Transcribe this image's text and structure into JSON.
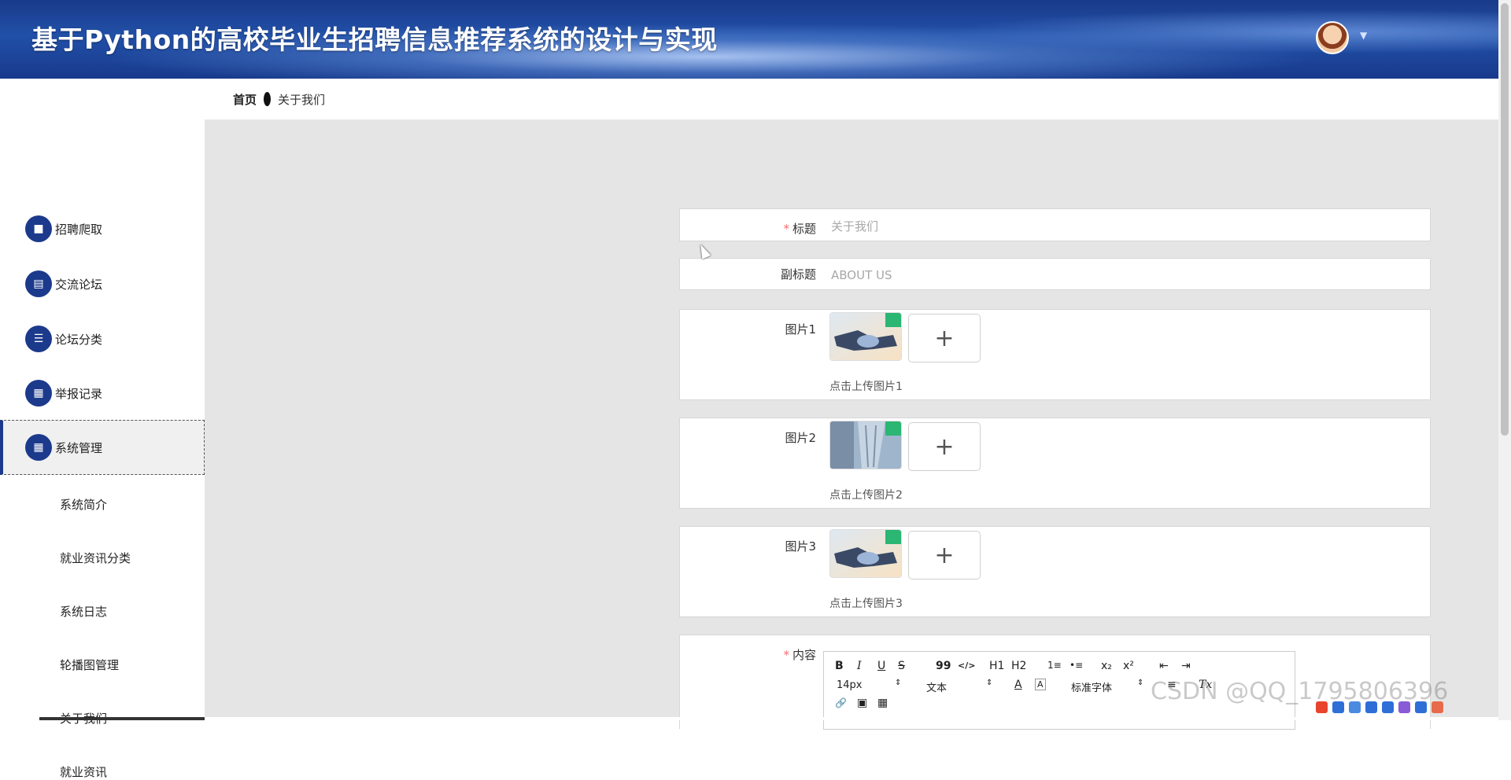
{
  "header": {
    "title": "基于Python的高校毕业生招聘信息推荐系统的设计与实现"
  },
  "breadcrumb": {
    "home": "首页",
    "current": "关于我们"
  },
  "sidebar": {
    "items": [
      {
        "label": "招聘爬取",
        "icon": "briefcase-icon"
      },
      {
        "label": "交流论坛",
        "icon": "clipboard-icon"
      },
      {
        "label": "论坛分类",
        "icon": "list-icon"
      },
      {
        "label": "举报记录",
        "icon": "grid-icon"
      },
      {
        "label": "系统管理",
        "icon": "grid-icon",
        "active": true
      }
    ],
    "sub_items": [
      "系统简介",
      "就业资讯分类",
      "系统日志",
      "轮播图管理",
      "关于我们",
      "就业资讯"
    ]
  },
  "form": {
    "title_label": "标题",
    "title_value": "关于我们",
    "subtitle_label": "副标题",
    "subtitle_value": "ABOUT US",
    "pic1_label": "图片1",
    "pic1_tip": "点击上传图片1",
    "pic2_label": "图片2",
    "pic2_tip": "点击上传图片2",
    "pic3_label": "图片3",
    "pic3_tip": "点击上传图片3",
    "content_label": "内容",
    "upload_plus": "+"
  },
  "editor": {
    "bold": "B",
    "italic": "I",
    "underline": "U",
    "strike": "S",
    "quote": "99",
    "code": "</>",
    "h1": "H1",
    "h2": "H2",
    "ol": "1≡",
    "ul": "•≡",
    "sub": "x₂",
    "sup": "x²",
    "outdent": "⇤",
    "indent": "⇥",
    "size": "14px",
    "format": "文本",
    "font_color": "A",
    "bg_color": "A",
    "font": "标准字体",
    "align": "≡",
    "clear": "Tx",
    "link": "🔗",
    "image": "▣",
    "video": "▦"
  },
  "watermark": "CSDN @QQ_1795806396",
  "colors": {
    "primary": "#1c3a8c",
    "required": "#f56c6c"
  }
}
